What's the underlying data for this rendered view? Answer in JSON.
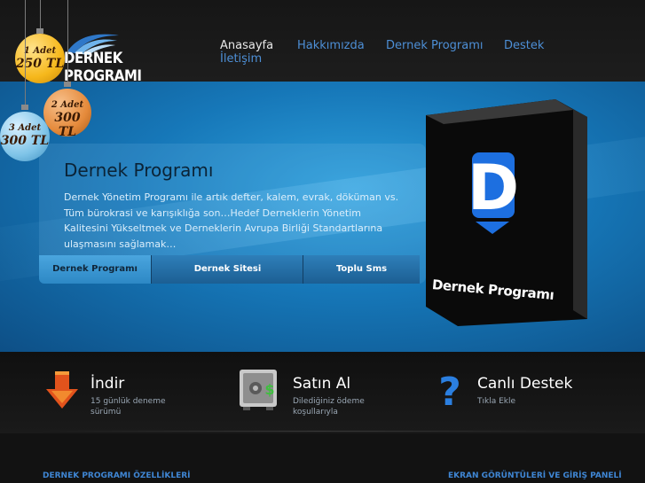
{
  "logo": {
    "text": "DERNEK PROGRAMI"
  },
  "nav": {
    "items": [
      {
        "label": "Anasayfa",
        "active": true
      },
      {
        "label": "Hakkımızda",
        "active": false
      },
      {
        "label": "Dernek Programı",
        "active": false
      },
      {
        "label": "Destek",
        "active": false
      },
      {
        "label": "İletişim",
        "active": false
      }
    ]
  },
  "pricing": [
    {
      "count": "1 Adet",
      "price": "250 TL",
      "color": "#f6b81c"
    },
    {
      "count": "2 Adet",
      "price": "300 TL",
      "color": "#e58a3b"
    },
    {
      "count": "3 Adet",
      "price": "300 TL",
      "color": "#7fc4e8"
    }
  ],
  "hero": {
    "title": "Dernek Programı",
    "text": "Dernek Yönetim Programı ile artık defter, kalem, evrak, döküman vs. Tüm bürokrasi ve karışıklığa son…Hedef Derneklerin Yönetim Kalitesini Yükseltmek ve Derneklerin Avrupa Birliği Standartlarına ulaşmasını sağlamak…",
    "tabs": [
      {
        "label": "Dernek Programı",
        "active": true
      },
      {
        "label": "Dernek Sitesi",
        "active": false
      },
      {
        "label": "Toplu Sms",
        "active": false
      }
    ],
    "product_box": {
      "letter": "D",
      "label": "Dernek Programı"
    }
  },
  "features": [
    {
      "icon": "download-arrow-icon",
      "title": "İndir",
      "subtitle": "15 günlük deneme sürümü"
    },
    {
      "icon": "safe-money-icon",
      "title": "Satın Al",
      "subtitle": "Dilediğiniz ödeme koşullarıyla"
    },
    {
      "icon": "question-mark-icon",
      "title": "Canlı Destek",
      "subtitle": "Tıkla Ekle"
    }
  ],
  "footer": {
    "left_link": "DERNEK PROGRAMI ÖZELLİKLERİ",
    "right_link": "EKRAN GÖRÜNTÜLERİ VE GİRİŞ PANELİ"
  },
  "colors": {
    "nav_link": "#4d8fd6",
    "hero_blue": "#1677b8",
    "footer_link": "#3f86d4"
  }
}
